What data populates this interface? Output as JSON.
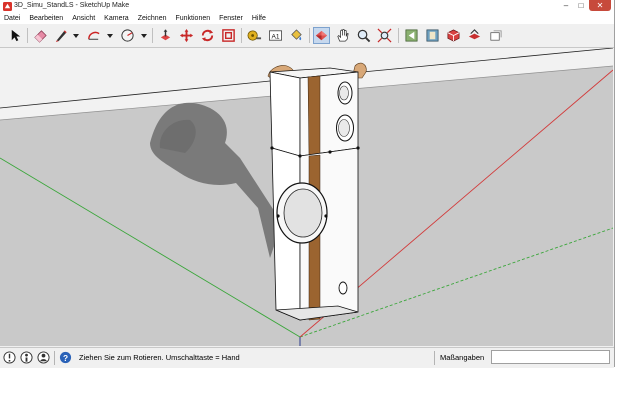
{
  "window": {
    "title": "3D_Simu_StandLS - SketchUp Make"
  },
  "menu": [
    "Datei",
    "Bearbeiten",
    "Ansicht",
    "Kamera",
    "Zeichnen",
    "Funktionen",
    "Fenster",
    "Hilfe"
  ],
  "toolbar": {
    "tools": [
      "select-tool",
      "eraser-tool",
      "pencil-tool",
      "arc-tool",
      "shapes-tool",
      "push-pull-tool",
      "move-tool",
      "rotate-tool",
      "tape-measure-tool",
      "text-tool",
      "paint-bucket-tool",
      "orbit-tool",
      "pan-tool",
      "zoom-tool",
      "zoom-extents-tool",
      "warehouse-tool",
      "extension-tool",
      "share-model-tool",
      "share-component-tool"
    ],
    "text_tool_glyph": "A1",
    "active_tool": "orbit-tool"
  },
  "status": {
    "text": "Ziehen Sie zum Rotieren.  Umschalttaste = Hand",
    "measurements_label": "Maßangaben",
    "measurements_value": ""
  },
  "colors": {
    "viewport_background": "#c9c9c9",
    "sky": "#f2f2f2",
    "axis_red": "#d23a3a",
    "axis_green": "#3aa63a",
    "axis_blue": "#2b3a8c",
    "wood_strip": "#9b6430"
  }
}
